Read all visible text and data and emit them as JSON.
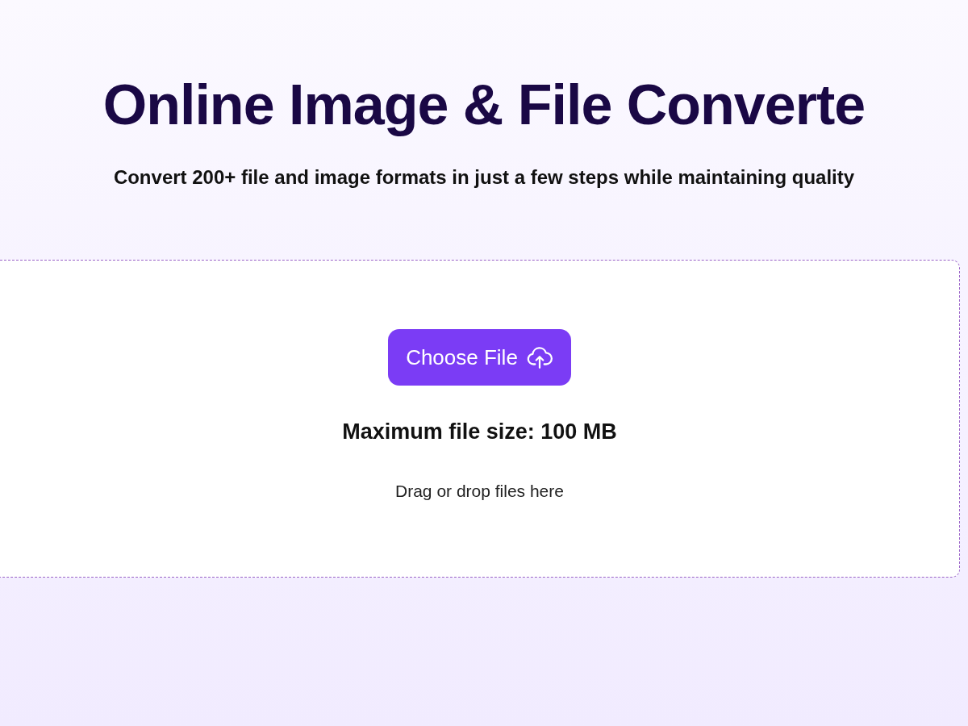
{
  "title": "Online Image & File Converte",
  "subtitle": "Convert 200+ file and image formats in just a few steps while maintaining quality",
  "upload": {
    "button": "Choose File",
    "max_size": "Maximum file size: 100 MB",
    "hint": "Drag or drop files here"
  }
}
